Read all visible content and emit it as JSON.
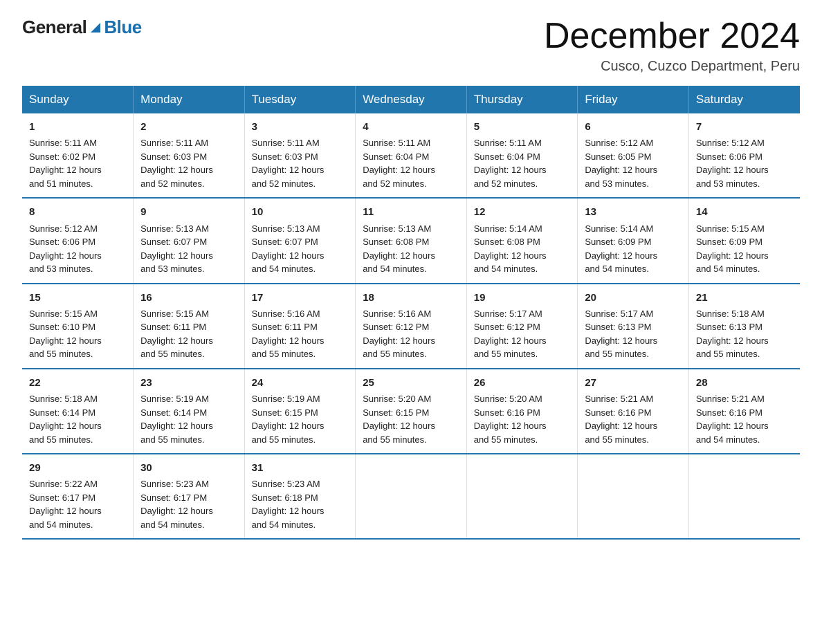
{
  "logo": {
    "general": "General",
    "blue": "Blue"
  },
  "header": {
    "month_title": "December 2024",
    "location": "Cusco, Cuzco Department, Peru"
  },
  "days_of_week": [
    "Sunday",
    "Monday",
    "Tuesday",
    "Wednesday",
    "Thursday",
    "Friday",
    "Saturday"
  ],
  "weeks": [
    [
      {
        "day": "1",
        "sunrise": "5:11 AM",
        "sunset": "6:02 PM",
        "daylight": "12 hours and 51 minutes."
      },
      {
        "day": "2",
        "sunrise": "5:11 AM",
        "sunset": "6:03 PM",
        "daylight": "12 hours and 52 minutes."
      },
      {
        "day": "3",
        "sunrise": "5:11 AM",
        "sunset": "6:03 PM",
        "daylight": "12 hours and 52 minutes."
      },
      {
        "day": "4",
        "sunrise": "5:11 AM",
        "sunset": "6:04 PM",
        "daylight": "12 hours and 52 minutes."
      },
      {
        "day": "5",
        "sunrise": "5:11 AM",
        "sunset": "6:04 PM",
        "daylight": "12 hours and 52 minutes."
      },
      {
        "day": "6",
        "sunrise": "5:12 AM",
        "sunset": "6:05 PM",
        "daylight": "12 hours and 53 minutes."
      },
      {
        "day": "7",
        "sunrise": "5:12 AM",
        "sunset": "6:06 PM",
        "daylight": "12 hours and 53 minutes."
      }
    ],
    [
      {
        "day": "8",
        "sunrise": "5:12 AM",
        "sunset": "6:06 PM",
        "daylight": "12 hours and 53 minutes."
      },
      {
        "day": "9",
        "sunrise": "5:13 AM",
        "sunset": "6:07 PM",
        "daylight": "12 hours and 53 minutes."
      },
      {
        "day": "10",
        "sunrise": "5:13 AM",
        "sunset": "6:07 PM",
        "daylight": "12 hours and 54 minutes."
      },
      {
        "day": "11",
        "sunrise": "5:13 AM",
        "sunset": "6:08 PM",
        "daylight": "12 hours and 54 minutes."
      },
      {
        "day": "12",
        "sunrise": "5:14 AM",
        "sunset": "6:08 PM",
        "daylight": "12 hours and 54 minutes."
      },
      {
        "day": "13",
        "sunrise": "5:14 AM",
        "sunset": "6:09 PM",
        "daylight": "12 hours and 54 minutes."
      },
      {
        "day": "14",
        "sunrise": "5:15 AM",
        "sunset": "6:09 PM",
        "daylight": "12 hours and 54 minutes."
      }
    ],
    [
      {
        "day": "15",
        "sunrise": "5:15 AM",
        "sunset": "6:10 PM",
        "daylight": "12 hours and 55 minutes."
      },
      {
        "day": "16",
        "sunrise": "5:15 AM",
        "sunset": "6:11 PM",
        "daylight": "12 hours and 55 minutes."
      },
      {
        "day": "17",
        "sunrise": "5:16 AM",
        "sunset": "6:11 PM",
        "daylight": "12 hours and 55 minutes."
      },
      {
        "day": "18",
        "sunrise": "5:16 AM",
        "sunset": "6:12 PM",
        "daylight": "12 hours and 55 minutes."
      },
      {
        "day": "19",
        "sunrise": "5:17 AM",
        "sunset": "6:12 PM",
        "daylight": "12 hours and 55 minutes."
      },
      {
        "day": "20",
        "sunrise": "5:17 AM",
        "sunset": "6:13 PM",
        "daylight": "12 hours and 55 minutes."
      },
      {
        "day": "21",
        "sunrise": "5:18 AM",
        "sunset": "6:13 PM",
        "daylight": "12 hours and 55 minutes."
      }
    ],
    [
      {
        "day": "22",
        "sunrise": "5:18 AM",
        "sunset": "6:14 PM",
        "daylight": "12 hours and 55 minutes."
      },
      {
        "day": "23",
        "sunrise": "5:19 AM",
        "sunset": "6:14 PM",
        "daylight": "12 hours and 55 minutes."
      },
      {
        "day": "24",
        "sunrise": "5:19 AM",
        "sunset": "6:15 PM",
        "daylight": "12 hours and 55 minutes."
      },
      {
        "day": "25",
        "sunrise": "5:20 AM",
        "sunset": "6:15 PM",
        "daylight": "12 hours and 55 minutes."
      },
      {
        "day": "26",
        "sunrise": "5:20 AM",
        "sunset": "6:16 PM",
        "daylight": "12 hours and 55 minutes."
      },
      {
        "day": "27",
        "sunrise": "5:21 AM",
        "sunset": "6:16 PM",
        "daylight": "12 hours and 55 minutes."
      },
      {
        "day": "28",
        "sunrise": "5:21 AM",
        "sunset": "6:16 PM",
        "daylight": "12 hours and 54 minutes."
      }
    ],
    [
      {
        "day": "29",
        "sunrise": "5:22 AM",
        "sunset": "6:17 PM",
        "daylight": "12 hours and 54 minutes."
      },
      {
        "day": "30",
        "sunrise": "5:23 AM",
        "sunset": "6:17 PM",
        "daylight": "12 hours and 54 minutes."
      },
      {
        "day": "31",
        "sunrise": "5:23 AM",
        "sunset": "6:18 PM",
        "daylight": "12 hours and 54 minutes."
      },
      null,
      null,
      null,
      null
    ]
  ],
  "labels": {
    "sunrise": "Sunrise:",
    "sunset": "Sunset:",
    "daylight": "Daylight:"
  }
}
